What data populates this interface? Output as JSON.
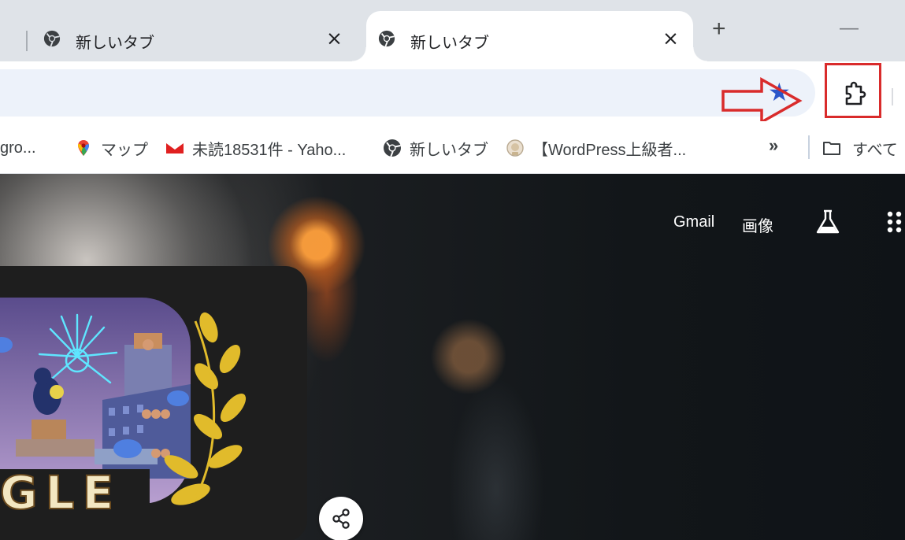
{
  "tabs": [
    {
      "title": "新しいタブ",
      "close": "×",
      "active": false,
      "icon": "chrome-icon"
    },
    {
      "title": "新しいタブ",
      "close": "×",
      "active": true,
      "icon": "chrome-icon"
    }
  ],
  "tabstrip": {
    "new_tab": "+",
    "minimize": "—"
  },
  "omnibox": {
    "value": "",
    "placeholder": ""
  },
  "bookmarks": [
    {
      "label": "gro...",
      "icon": "none"
    },
    {
      "label": "マップ",
      "icon": "maps-pin-icon"
    },
    {
      "label": "未読18531件 - Yaho...",
      "icon": "mail-icon"
    },
    {
      "label": "新しいタブ",
      "icon": "chrome-icon"
    },
    {
      "label": "【WordPress上級者...",
      "icon": "site-favicon-icon"
    }
  ],
  "bookmarks_overflow": "»",
  "all_bookmarks": "すべて",
  "header_links": {
    "gmail": "Gmail",
    "images": "画像"
  },
  "doodle": {
    "text": "GLE"
  },
  "colors": {
    "accent": "#2b56c9",
    "annotation": "#d92b2b",
    "omnibox_bg": "#edf2fa",
    "tabstrip_bg": "#dfe3e8"
  }
}
